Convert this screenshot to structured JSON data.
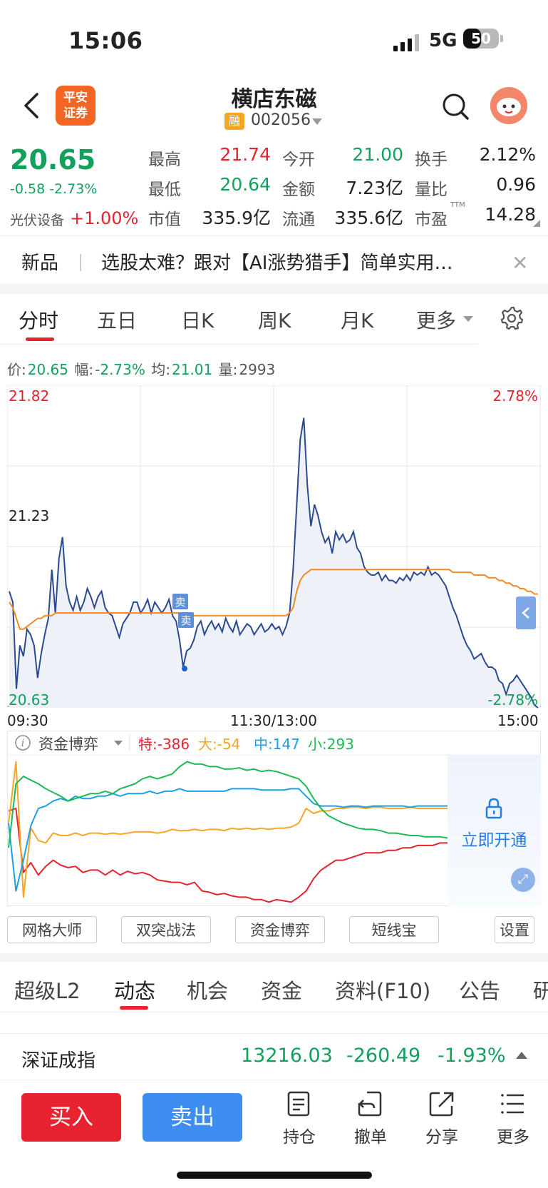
{
  "status_bar": {
    "time": "15:06",
    "network": "5G",
    "battery": "50"
  },
  "header": {
    "logo_text": "平安证券",
    "stock_name": "横店东磁",
    "margin_badge": "融",
    "stock_code": "002056"
  },
  "quote": {
    "price": "20.65",
    "change": "-0.58 -2.73%",
    "sector_label": "光伏设备",
    "sector_change": "+1.00%",
    "fields": [
      {
        "label": "最高",
        "value": "21.74",
        "color": "#e8222e"
      },
      {
        "label": "今开",
        "value": "21.00",
        "color": "#12a05c"
      },
      {
        "label": "换手",
        "value": "2.12%",
        "color": "#222222"
      },
      {
        "label": "最低",
        "value": "20.64",
        "color": "#12a05c"
      },
      {
        "label": "金额",
        "value": "7.23亿",
        "color": "#222222"
      },
      {
        "label": "量比",
        "value": "0.96",
        "color": "#222222"
      },
      {
        "label": "市值",
        "value": "335.9亿",
        "color": "#222222"
      },
      {
        "label": "流通",
        "value": "335.6亿",
        "color": "#222222"
      },
      {
        "label": "市盈",
        "value": "14.28",
        "color": "#222222"
      }
    ],
    "pe_suffix": "TTM"
  },
  "banner": {
    "tag": "新品",
    "text": "选股太难？跟对【AI涨势猎手】简单实用…",
    "close_icon": "close-icon"
  },
  "chart_tabs": [
    "分时",
    "五日",
    "日K",
    "周K",
    "月K",
    "更多"
  ],
  "chart_info": {
    "price_label": "价:",
    "price": "20.65",
    "range_label": "幅:",
    "range": "-2.73%",
    "avg_label": "均:",
    "avg": "21.01",
    "vol_label": "量:",
    "vol": "2993"
  },
  "chart_data": {
    "type": "line",
    "x_ticks": [
      "09:30",
      "11:30/13:00",
      "15:00"
    ],
    "y_ticks_left": [
      "21.82",
      "21.23",
      "20.63"
    ],
    "y_ticks_right": [
      "2.78%",
      "-2.78%"
    ],
    "ylim": [
      20.63,
      21.82
    ],
    "prev_close": 21.23,
    "grid": true,
    "sell_markers": [
      "卖",
      "卖"
    ],
    "series": [
      {
        "values": [
          21.06,
          21.02,
          20.7,
          20.86,
          20.82,
          20.92,
          20.9,
          20.86,
          20.74,
          20.83,
          20.9,
          20.96,
          21.14,
          20.98,
          21.18,
          21.26,
          21.08,
          21.02,
          20.99,
          21.04,
          20.99,
          21.02,
          21.07,
          21.04,
          21.0,
          21.04,
          21.06,
          21.0,
          20.98,
          20.97,
          20.93,
          20.89,
          20.94,
          20.96,
          20.98,
          21.02,
          21.02,
          20.98,
          21.0,
          21.03,
          20.98,
          21.02,
          21.0,
          20.98,
          21.0,
          21.03,
          20.97,
          20.95,
          20.88,
          20.78,
          20.84,
          20.85,
          20.88,
          20.93,
          20.95,
          20.9,
          20.93,
          20.95,
          20.92,
          20.94,
          20.91,
          20.96,
          20.93,
          20.91,
          20.95,
          20.9,
          20.92,
          20.94,
          20.93,
          20.9,
          20.92,
          20.94,
          20.91,
          20.92,
          20.94,
          20.92,
          20.93,
          20.9,
          20.93,
          20.98,
          21.14,
          21.38,
          21.62,
          21.7,
          21.45,
          21.3,
          21.38,
          21.34,
          21.28,
          21.24,
          21.26,
          21.2,
          21.28,
          21.25,
          21.27,
          21.24,
          21.25,
          21.28,
          21.22,
          21.2,
          21.15,
          21.13,
          21.12,
          21.12,
          21.13,
          21.1,
          21.12,
          21.1,
          21.1,
          21.09,
          21.11,
          21.1,
          21.12,
          21.1,
          21.13,
          21.12,
          21.13,
          21.12,
          21.15,
          21.12,
          21.13,
          21.12,
          21.1,
          21.08,
          21.04,
          21.0,
          20.97,
          20.93,
          20.89,
          20.86,
          20.84,
          20.81,
          20.82,
          20.83,
          20.8,
          20.78,
          20.78,
          20.77,
          20.73,
          20.72,
          20.68,
          20.72,
          20.73,
          20.75,
          20.73,
          20.71,
          20.69,
          20.67,
          20.64,
          20.63
        ],
        "color": "#2b4a8f"
      },
      {
        "values": [
          21.02,
          21.0,
          20.96,
          20.92,
          20.92,
          20.93,
          20.94,
          20.95,
          20.96,
          20.96,
          20.97,
          20.97,
          20.97,
          20.98,
          20.98,
          20.98,
          20.98,
          20.98,
          20.98,
          20.98,
          20.98,
          20.98,
          20.98,
          20.98,
          20.98,
          20.98,
          20.98,
          20.98,
          20.98,
          20.98,
          20.98,
          20.98,
          20.98,
          20.98,
          20.98,
          20.98,
          20.98,
          20.98,
          20.98,
          20.98,
          20.98,
          20.98,
          20.98,
          20.98,
          20.98,
          20.98,
          20.98,
          20.98,
          20.98,
          20.97,
          20.97,
          20.97,
          20.97,
          20.97,
          20.97,
          20.97,
          20.97,
          20.97,
          20.97,
          20.97,
          20.97,
          20.97,
          20.97,
          20.97,
          20.97,
          20.97,
          20.97,
          20.97,
          20.97,
          20.97,
          20.97,
          20.97,
          20.97,
          20.97,
          20.97,
          20.97,
          20.97,
          20.97,
          20.97,
          20.98,
          21.0,
          21.06,
          21.1,
          21.12,
          21.13,
          21.14,
          21.14,
          21.14,
          21.14,
          21.14,
          21.14,
          21.14,
          21.14,
          21.14,
          21.14,
          21.14,
          21.14,
          21.14,
          21.14,
          21.14,
          21.14,
          21.14,
          21.14,
          21.14,
          21.14,
          21.14,
          21.14,
          21.14,
          21.14,
          21.14,
          21.14,
          21.14,
          21.14,
          21.14,
          21.14,
          21.14,
          21.14,
          21.14,
          21.14,
          21.14,
          21.14,
          21.14,
          21.14,
          21.14,
          21.14,
          21.13,
          21.13,
          21.13,
          21.13,
          21.13,
          21.13,
          21.12,
          21.12,
          21.12,
          21.12,
          21.11,
          21.11,
          21.11,
          21.1,
          21.1,
          21.09,
          21.09,
          21.08,
          21.08,
          21.07,
          21.07,
          21.06,
          21.06,
          21.05,
          21.05
        ],
        "color": "#f08a24"
      }
    ]
  },
  "fund_panel": {
    "info_icon": "i",
    "title": "资金博弈",
    "legend": [
      {
        "label": "特:-386",
        "color": "#e8222e"
      },
      {
        "label": "大:-54",
        "color": "#f5a623"
      },
      {
        "label": "中:147",
        "color": "#1aa0e8"
      },
      {
        "label": "小:293",
        "color": "#1db954"
      }
    ],
    "unlock_text": "立即开通",
    "lines": [
      {
        "color": "#e8222e",
        "values": [
          0.7,
          0.72,
          0.2,
          0.28,
          0.18,
          0.25,
          0.3,
          0.26,
          0.24,
          0.25,
          0.2,
          0.22,
          0.22,
          0.18,
          0.22,
          0.18,
          0.21,
          0.19,
          0.2,
          0.18,
          0.14,
          0.13,
          0.12,
          0.12,
          0.1,
          0.12,
          0.05,
          0.04,
          0.02,
          0.03,
          0.01,
          0.0,
          0.0,
          -0.02,
          -0.02,
          -0.04,
          -0.02,
          -0.03,
          -0.04,
          0.0,
          0.05,
          0.15,
          0.22,
          0.26,
          0.3,
          0.3,
          0.32,
          0.34,
          0.36,
          0.36,
          0.36,
          0.38,
          0.38,
          0.4,
          0.4,
          0.42,
          0.42,
          0.42,
          0.44,
          0.44
        ]
      },
      {
        "color": "#f5a623",
        "values": [
          0.6,
          1.1,
          0.0,
          0.56,
          0.46,
          0.44,
          0.52,
          0.5,
          0.5,
          0.52,
          0.5,
          0.52,
          0.52,
          0.51,
          0.52,
          0.51,
          0.52,
          0.53,
          0.53,
          0.53,
          0.52,
          0.53,
          0.55,
          0.54,
          0.54,
          0.55,
          0.54,
          0.55,
          0.55,
          0.54,
          0.56,
          0.55,
          0.56,
          0.55,
          0.56,
          0.55,
          0.56,
          0.56,
          0.57,
          0.6,
          0.72,
          0.68,
          0.7,
          0.7,
          0.72,
          0.72,
          0.73,
          0.73,
          0.72,
          0.73,
          0.73,
          0.72,
          0.72,
          0.72,
          0.73,
          0.72,
          0.72,
          0.72,
          0.72,
          0.72
        ]
      },
      {
        "color": "#1aa0e8",
        "values": [
          0.6,
          0.05,
          0.3,
          0.58,
          0.72,
          0.74,
          0.78,
          0.8,
          0.78,
          0.82,
          0.8,
          0.8,
          0.82,
          0.82,
          0.84,
          0.82,
          0.84,
          0.84,
          0.84,
          0.86,
          0.84,
          0.86,
          0.86,
          0.88,
          0.86,
          0.86,
          0.86,
          0.86,
          0.86,
          0.86,
          0.88,
          0.88,
          0.88,
          0.88,
          0.87,
          0.87,
          0.87,
          0.87,
          0.88,
          0.88,
          0.82,
          0.76,
          0.74,
          0.74,
          0.74,
          0.73,
          0.74,
          0.74,
          0.73,
          0.74,
          0.74,
          0.74,
          0.74,
          0.74,
          0.73,
          0.74,
          0.74,
          0.74,
          0.74,
          0.74
        ]
      },
      {
        "color": "#1db954",
        "values": [
          0.4,
          0.92,
          0.98,
          0.95,
          0.92,
          0.88,
          0.85,
          0.82,
          0.78,
          0.8,
          0.82,
          0.84,
          0.84,
          0.86,
          0.84,
          0.88,
          0.9,
          0.92,
          0.96,
          0.98,
          0.96,
          0.98,
          1.0,
          1.06,
          1.1,
          1.08,
          1.08,
          1.06,
          1.06,
          1.04,
          1.04,
          1.05,
          1.03,
          1.04,
          1.02,
          1.03,
          1.02,
          1.0,
          0.98,
          0.96,
          0.9,
          0.8,
          0.72,
          0.66,
          0.63,
          0.6,
          0.58,
          0.56,
          0.55,
          0.55,
          0.54,
          0.52,
          0.52,
          0.51,
          0.5,
          0.5,
          0.49,
          0.49,
          0.49,
          0.48
        ]
      }
    ]
  },
  "tools": [
    "网格大师",
    "双突战法",
    "资金博弈",
    "短线宝",
    "设置"
  ],
  "bottom_tabs": [
    "超级L2",
    "动态",
    "机会",
    "资金",
    "资料(F10)",
    "公告",
    "研"
  ],
  "index_bar": {
    "name": "深证成指",
    "value": "13216.03",
    "change": "-260.49",
    "percent": "-1.93%"
  },
  "actions": {
    "buy": "买入",
    "sell": "卖出",
    "items": [
      {
        "label": "持仓",
        "icon": "document-icon"
      },
      {
        "label": "撤单",
        "icon": "undo-icon"
      },
      {
        "label": "分享",
        "icon": "share-icon"
      },
      {
        "label": "更多",
        "icon": "menu-icon"
      }
    ]
  }
}
